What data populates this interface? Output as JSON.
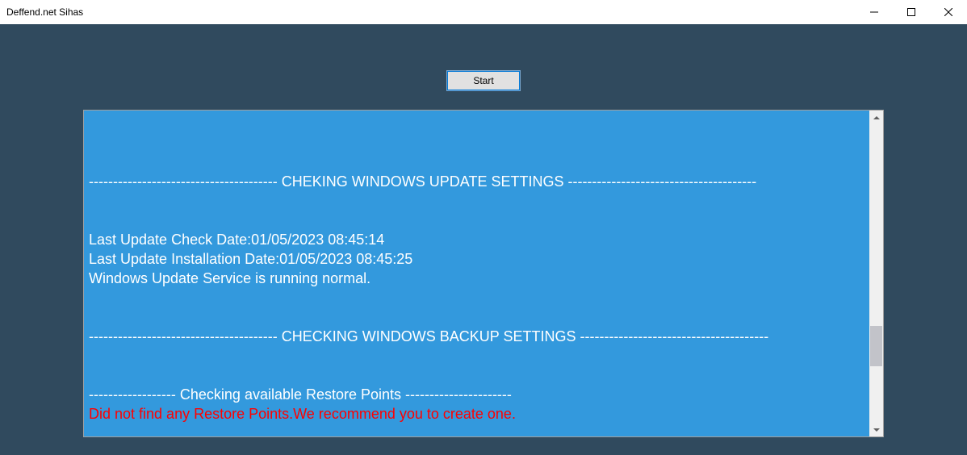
{
  "window": {
    "title": "Deffend.net Sihas"
  },
  "toolbar": {
    "start_label": "Start"
  },
  "output": {
    "lines": [
      {
        "text": "",
        "warn": false
      },
      {
        "text": "",
        "warn": false
      },
      {
        "text": "",
        "warn": false
      },
      {
        "text": "--------------------------------------- CHEKING WINDOWS UPDATE SETTINGS ---------------------------------------",
        "warn": false
      },
      {
        "text": "",
        "warn": false
      },
      {
        "text": "",
        "warn": false
      },
      {
        "text": "Last Update Check Date:01/05/2023 08:45:14",
        "warn": false
      },
      {
        "text": "Last Update Installation Date:01/05/2023 08:45:25",
        "warn": false
      },
      {
        "text": "Windows Update Service is running normal.",
        "warn": false
      },
      {
        "text": "",
        "warn": false
      },
      {
        "text": "",
        "warn": false
      },
      {
        "text": "--------------------------------------- CHECKING WINDOWS BACKUP SETTINGS ---------------------------------------",
        "warn": false
      },
      {
        "text": "",
        "warn": false
      },
      {
        "text": "",
        "warn": false
      },
      {
        "text": "------------------ Checking available Restore Points ----------------------",
        "warn": false
      },
      {
        "text": "Did not find any Restore Points.We recommend you to create one.",
        "warn": true
      }
    ]
  }
}
